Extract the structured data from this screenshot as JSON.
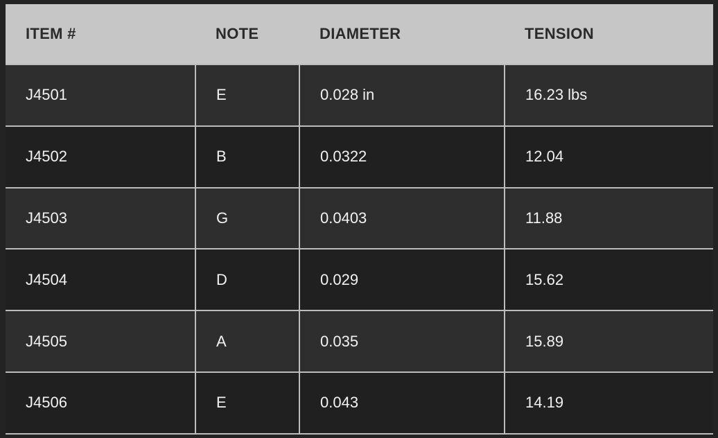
{
  "table": {
    "headers": [
      "ITEM #",
      "NOTE",
      "DIAMETER",
      "TENSION"
    ],
    "rows": [
      [
        "J4501",
        "E",
        "0.028 in",
        "16.23 lbs"
      ],
      [
        "J4502",
        "B",
        "0.0322",
        "12.04"
      ],
      [
        "J4503",
        "G",
        "0.0403",
        "11.88"
      ],
      [
        "J4504",
        "D",
        "0.029",
        "15.62"
      ],
      [
        "J4505",
        "A",
        "0.035",
        "15.89"
      ],
      [
        "J4506",
        "E",
        "0.043",
        "14.19"
      ]
    ]
  },
  "colors": {
    "header_bg": "#c6c6c6",
    "header_text": "#2a2a2a",
    "row_odd_bg": "#2e2e2e",
    "row_even_bg": "#202020",
    "cell_text": "#f2f2f2",
    "grid_line": "#bdbdbd"
  }
}
